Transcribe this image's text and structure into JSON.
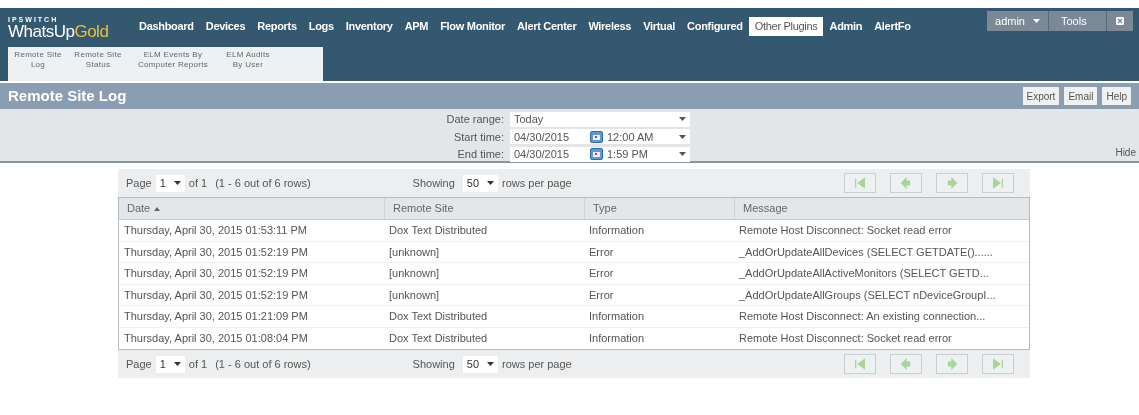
{
  "logo": {
    "brand": "IPSWITCH",
    "name": "WhatsUp",
    "accent": "Gold"
  },
  "nav": [
    {
      "label": "Dashboard",
      "selected": false
    },
    {
      "label": "Devices",
      "selected": false
    },
    {
      "label": "Reports",
      "selected": false
    },
    {
      "label": "Logs",
      "selected": false
    },
    {
      "label": "Inventory",
      "selected": false
    },
    {
      "label": "APM",
      "selected": false
    },
    {
      "label": "Flow Monitor",
      "selected": false
    },
    {
      "label": "Alert Center",
      "selected": false
    },
    {
      "label": "Wireless",
      "selected": false
    },
    {
      "label": "Virtual",
      "selected": false
    },
    {
      "label": "Configured",
      "selected": false
    },
    {
      "label": "Other Plugins",
      "selected": true
    },
    {
      "label": "Admin",
      "selected": false
    },
    {
      "label": "AlertFo",
      "selected": false
    }
  ],
  "user_menu": {
    "user": "admin",
    "tools": "Tools"
  },
  "submenu": [
    "Remote Site Log",
    "Remote Site Status",
    "ELM Events By Computer Reports",
    "ELM Audits By User"
  ],
  "page_title": "Remote Site Log",
  "actions": [
    "Export",
    "Email",
    "Help"
  ],
  "filters": {
    "date_range_label": "Date range:",
    "date_range": "Today",
    "start_label": "Start time:",
    "start_date": "04/30/2015",
    "start_time": "12:00 AM",
    "end_label": "End time:",
    "end_date": "04/30/2015",
    "end_time": "1:59 PM",
    "hide": "Hide"
  },
  "pagers": [
    {
      "page_label": "Page",
      "page": "1",
      "of": "of 1",
      "range": "(1 - 6 out of 6 rows)",
      "showing": "Showing",
      "per_page": "50",
      "rows_label": "rows per page"
    },
    {
      "page_label": "Page",
      "page": "1",
      "of": "of 1",
      "range": "(1 - 6 out of 6 rows)",
      "showing": "Showing",
      "per_page": "50",
      "rows_label": "rows per page"
    }
  ],
  "table": {
    "columns": [
      {
        "label": "Date",
        "sorted": true
      },
      {
        "label": "Remote Site",
        "sorted": false
      },
      {
        "label": "Type",
        "sorted": false
      },
      {
        "label": "Message",
        "sorted": false
      }
    ],
    "rows": [
      [
        "Thursday, April 30, 2015 01:53:11 PM",
        "Dox Text Distributed",
        "Information",
        "Remote Host Disconnect: Socket read error"
      ],
      [
        "Thursday, April 30, 2015 01:52:19 PM",
        "[unknown]",
        "Error",
        "_AddOrUpdateAllDevices (SELECT GETDATE()......"
      ],
      [
        "Thursday, April 30, 2015 01:52:19 PM",
        "[unknown]",
        "Error",
        "_AddOrUpdateAllActiveMonitors (SELECT GETD..."
      ],
      [
        "Thursday, April 30, 2015 01:52:19 PM",
        "[unknown]",
        "Error",
        "_AddOrUpdateAllGroups (SELECT nDeviceGroupI..."
      ],
      [
        "Thursday, April 30, 2015 01:21:09 PM",
        "Dox Text Distributed",
        "Information",
        "Remote Host Disconnect: An existing connection..."
      ],
      [
        "Thursday, April 30, 2015 01:08:04 PM",
        "Dox Text Distributed",
        "Information",
        "Remote Host Disconnect: Socket read error"
      ]
    ]
  }
}
